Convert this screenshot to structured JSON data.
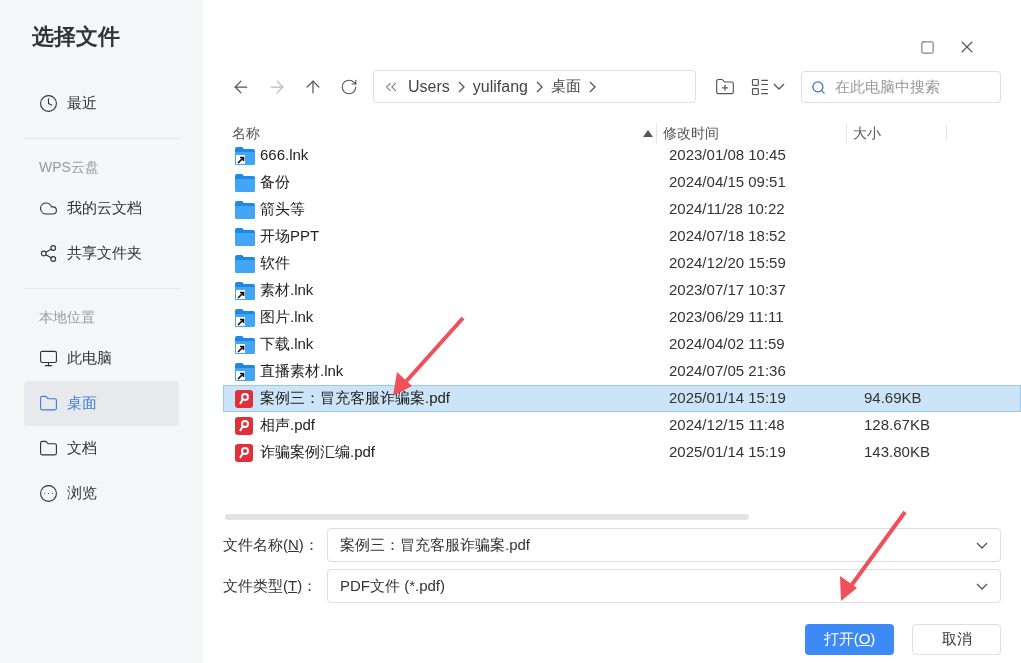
{
  "window": {
    "title": "选择文件"
  },
  "sidebar": {
    "sections": [
      {
        "items": [
          {
            "label": "最近",
            "selected": false
          }
        ]
      },
      {
        "heading": "WPS云盘",
        "items": [
          {
            "label": "我的云文档",
            "selected": false
          },
          {
            "label": "共享文件夹",
            "selected": false
          }
        ]
      },
      {
        "heading": "本地位置",
        "items": [
          {
            "label": "此电脑",
            "selected": false
          },
          {
            "label": "桌面",
            "selected": true
          },
          {
            "label": "文档",
            "selected": false
          },
          {
            "label": "浏览",
            "selected": false
          }
        ]
      }
    ]
  },
  "breadcrumb": [
    "Users",
    "yulifang",
    "桌面"
  ],
  "search": {
    "placeholder": "在此电脑中搜索"
  },
  "table": {
    "columns": [
      "名称",
      "修改时间",
      "大小"
    ],
    "rows": [
      {
        "kind": "shortcut",
        "name": "666.lnk",
        "modified": "2023/01/08 10:45",
        "selected": false
      },
      {
        "kind": "folder",
        "name": "备份",
        "modified": "2024/04/15 09:51",
        "selected": false
      },
      {
        "kind": "folder",
        "name": "箭头等",
        "modified": "2024/11/28 10:22",
        "selected": false
      },
      {
        "kind": "folder",
        "name": "开场PPT",
        "modified": "2024/07/18 18:52",
        "selected": false
      },
      {
        "kind": "folder",
        "name": "软件",
        "modified": "2024/12/20 15:59",
        "selected": false
      },
      {
        "kind": "shortcut",
        "name": "素材.lnk",
        "modified": "2023/07/17 10:37",
        "selected": false
      },
      {
        "kind": "shortcut",
        "name": "图片.lnk",
        "modified": "2023/06/29 11:11",
        "selected": false
      },
      {
        "kind": "shortcut",
        "name": "下载.lnk",
        "modified": "2024/04/02 11:59",
        "selected": false
      },
      {
        "kind": "shortcut",
        "name": "直播素材.lnk",
        "modified": "2024/07/05 21:36",
        "selected": false
      },
      {
        "kind": "pdf",
        "name": "案例三：冒充客服诈骗案.pdf",
        "modified": "2025/01/14 15:19",
        "size": "94.69KB",
        "selected": true
      },
      {
        "kind": "pdf",
        "name": "相声.pdf",
        "modified": "2024/12/15 11:48",
        "size": "128.67KB",
        "selected": false
      },
      {
        "kind": "pdf",
        "name": "诈骗案例汇编.pdf",
        "modified": "2025/01/14 15:19",
        "size": "143.80KB",
        "selected": false
      }
    ]
  },
  "fields": [
    {
      "label_before": "文件名称(",
      "access_key": "N",
      "label_after": ")：",
      "value": "案例三：冒充客服诈骗案.pdf"
    },
    {
      "label_before": "文件类型(",
      "access_key": "T",
      "label_after": ")：",
      "value": "PDF文件 (*.pdf)"
    }
  ],
  "buttons": [
    {
      "label_before": "打开(",
      "access_key": "O",
      "label_after": ")",
      "kind": "primary"
    },
    {
      "label": "取消",
      "kind": "secondary"
    }
  ]
}
